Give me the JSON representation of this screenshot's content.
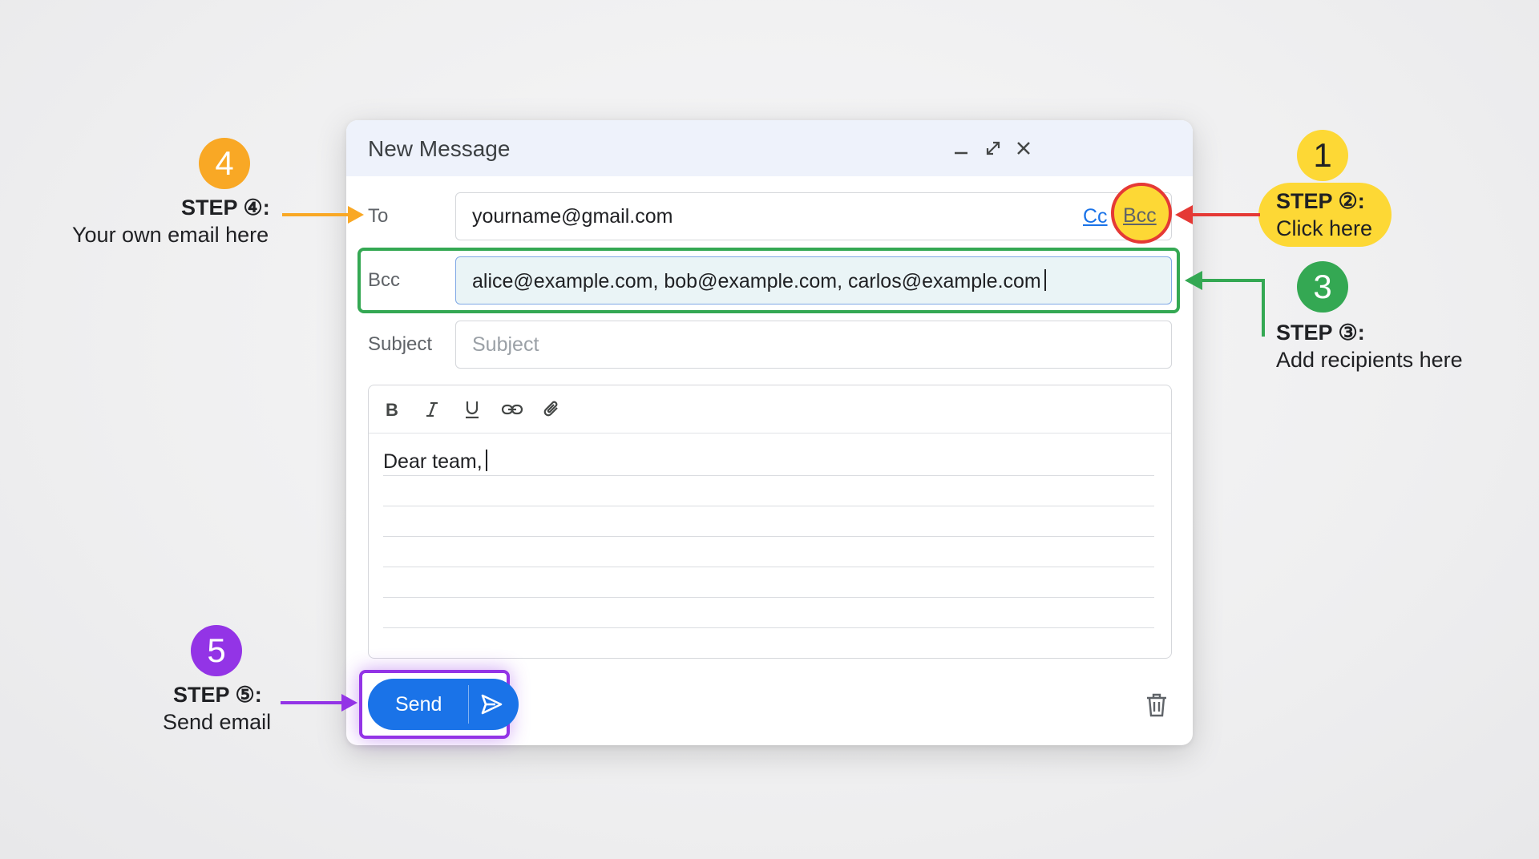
{
  "compose": {
    "title": "New Message",
    "to_label": "To",
    "to_value": "yourname@gmail.com",
    "cc_link": "Cc",
    "bcc_link": "Bcc",
    "bcc_label": "Bcc",
    "bcc_value": "alice@example.com, bob@example.com, carlos@example.com",
    "subject_label": "Subject",
    "subject_placeholder": "Subject",
    "body_text": "Dear team,",
    "send_label": "Send"
  },
  "toolbar_icons": [
    "bold-icon",
    "italic-icon",
    "underline-icon",
    "link-icon",
    "attachment-icon"
  ],
  "annotations": {
    "step1": {
      "number": "1",
      "title": "STEP ②:",
      "desc": "Click here",
      "color": "#fdd835"
    },
    "step3": {
      "number": "3",
      "title": "STEP ③:",
      "desc": "Add recipients here",
      "color": "#34a853"
    },
    "step4": {
      "number": "4",
      "title": "STEP ④:",
      "desc": "Your own email here",
      "color": "#f9a825"
    },
    "step5": {
      "number": "5",
      "title": "STEP ⑤:",
      "desc": "Send email",
      "color": "#9334e6"
    }
  },
  "colors": {
    "accent_blue": "#1a73e8",
    "arrow_red": "#e53935",
    "highlight_green": "#34a853",
    "highlight_purple": "#9334e6",
    "badge_orange": "#f9a825",
    "badge_yellow": "#fdd835"
  }
}
